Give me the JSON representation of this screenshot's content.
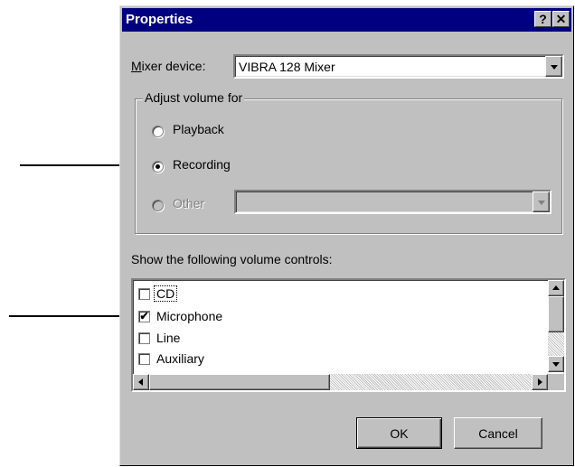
{
  "dialog": {
    "title": "Properties",
    "help_button": "?",
    "close_button": "✕"
  },
  "mixer": {
    "label_accel": "M",
    "label_rest": "ixer device:",
    "value": "VIBRA 128 Mixer"
  },
  "adjust_group": {
    "legend": "Adjust volume for",
    "options": [
      {
        "label": "Playback",
        "selected": false,
        "enabled": true
      },
      {
        "label": "Recording",
        "selected": true,
        "enabled": true
      },
      {
        "label": "Other",
        "selected": false,
        "enabled": false
      }
    ],
    "other_dropdown_value": ""
  },
  "controls": {
    "label": "Show the following volume controls:",
    "items": [
      {
        "label": "CD",
        "checked": false,
        "focused": true
      },
      {
        "label": "Microphone",
        "checked": true,
        "focused": false
      },
      {
        "label": "Line",
        "checked": false,
        "focused": false
      },
      {
        "label": "Auxiliary",
        "checked": false,
        "focused": false
      }
    ]
  },
  "buttons": {
    "ok": "OK",
    "cancel": "Cancel"
  },
  "icons": {
    "checkmark": "✔",
    "arrow": "right-arrow-icon"
  },
  "colors": {
    "titlebar": "#000080",
    "dialog_bg": "#c0c0c0",
    "disabled_text": "#808080"
  }
}
